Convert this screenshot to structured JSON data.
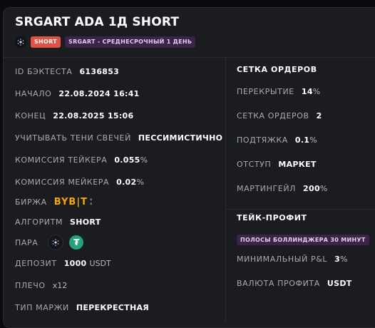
{
  "header": {
    "title": "SRGART ADA 1Д SHORT",
    "badge_short": "SHORT",
    "badge_strategy": "SRGART - СРЕДНЕСРОЧНЫЙ 1 ДЕНЬ"
  },
  "left": {
    "backtest_id_label": "ID БЭКТЕСТА",
    "backtest_id_value": "6136853",
    "start_label": "НАЧАЛО",
    "start_value": "22.08.2024 16:41",
    "end_label": "КОНЕЦ",
    "end_value": "22.08.2025 15:06",
    "shadows_label": "УЧИТЫВАТЬ ТЕНИ СВЕЧЕЙ",
    "shadows_value": "ПЕССИМИСТИЧНО",
    "taker_label": "КОМИССИЯ ТЕЙКЕРА",
    "taker_value": "0.055",
    "taker_unit": "%",
    "maker_label": "КОМИССИЯ МЕЙКЕРА",
    "maker_value": "0.02",
    "maker_unit": "%",
    "exchange_label": "БИРЖА",
    "exchange_logo_a": "BYB",
    "exchange_logo_b": "T",
    "algo_label": "АЛГОРИТМ",
    "algo_value": "SHORT",
    "pair_label": "ПАРА",
    "pair_icons": [
      "cardano-icon",
      "tether-icon"
    ],
    "deposit_label": "ДЕПОЗИТ",
    "deposit_value": "1000",
    "deposit_unit": "USDT",
    "leverage_label": "ПЛЕЧО",
    "leverage_value": "x12",
    "margin_label": "ТИП МАРЖИ",
    "margin_value": "ПЕРЕКРЕСТНАЯ"
  },
  "right": {
    "grid_title": "СЕТКА ОРДЕРОВ",
    "overlap_label": "ПЕРЕКРЫТИЕ",
    "overlap_value": "14",
    "overlap_unit": "%",
    "orders_label": "СЕТКА ОРДЕРОВ",
    "orders_value": "2",
    "pullup_label": "ПОДТЯЖКА",
    "pullup_value": "0.1",
    "pullup_unit": "%",
    "offset_label": "ОТСТУП",
    "offset_value": "МАРКЕТ",
    "martingale_label": "МАРТИНГЕЙЛ",
    "martingale_value": "200",
    "martingale_unit": "%",
    "tp_title": "ТЕЙК-ПРОФИТ",
    "tp_badge": "ПОЛОСЫ БОЛЛИНДЖЕРА 30 МИНУТ",
    "min_pnl_label": "МИНИМАЛЬНЫЙ P&L",
    "min_pnl_value": "3",
    "min_pnl_unit": "%",
    "profit_currency_label": "ВАЛЮТА ПРОФИТА",
    "profit_currency_value": "USDT"
  },
  "colors": {
    "short_badge": "#e05245",
    "strategy_badge": "#3a2549",
    "bybit": "#f7a600",
    "usdt": "#26a17b"
  }
}
